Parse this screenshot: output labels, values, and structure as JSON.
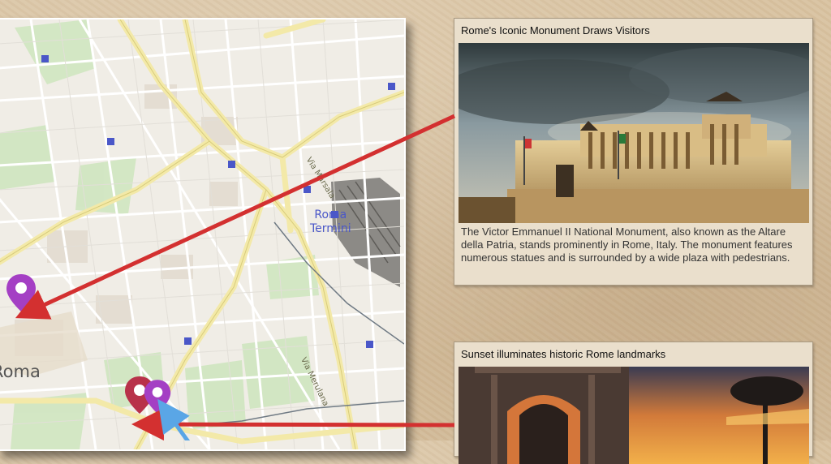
{
  "map": {
    "label_termini": "Roma\nTermini",
    "label_roma": "Roma",
    "street_1": "Via Marsala",
    "street_2": "Via Merulana"
  },
  "cards": [
    {
      "title": "Rome's Iconic Monument Draws Visitors",
      "description": "The Victor Emmanuel II National Monument, also known as the Altare della Patria, stands prominently in Rome, Italy. The monument features numerous statues and is surrounded by a wide plaza with pedestrians."
    },
    {
      "title": "Sunset illuminates historic Rome landmarks"
    }
  ],
  "colors": {
    "arrow": "#d33030",
    "pin_purple": "#a43fc4",
    "pin_red": "#b8324a",
    "arrow_blue": "#5aa6e6"
  }
}
